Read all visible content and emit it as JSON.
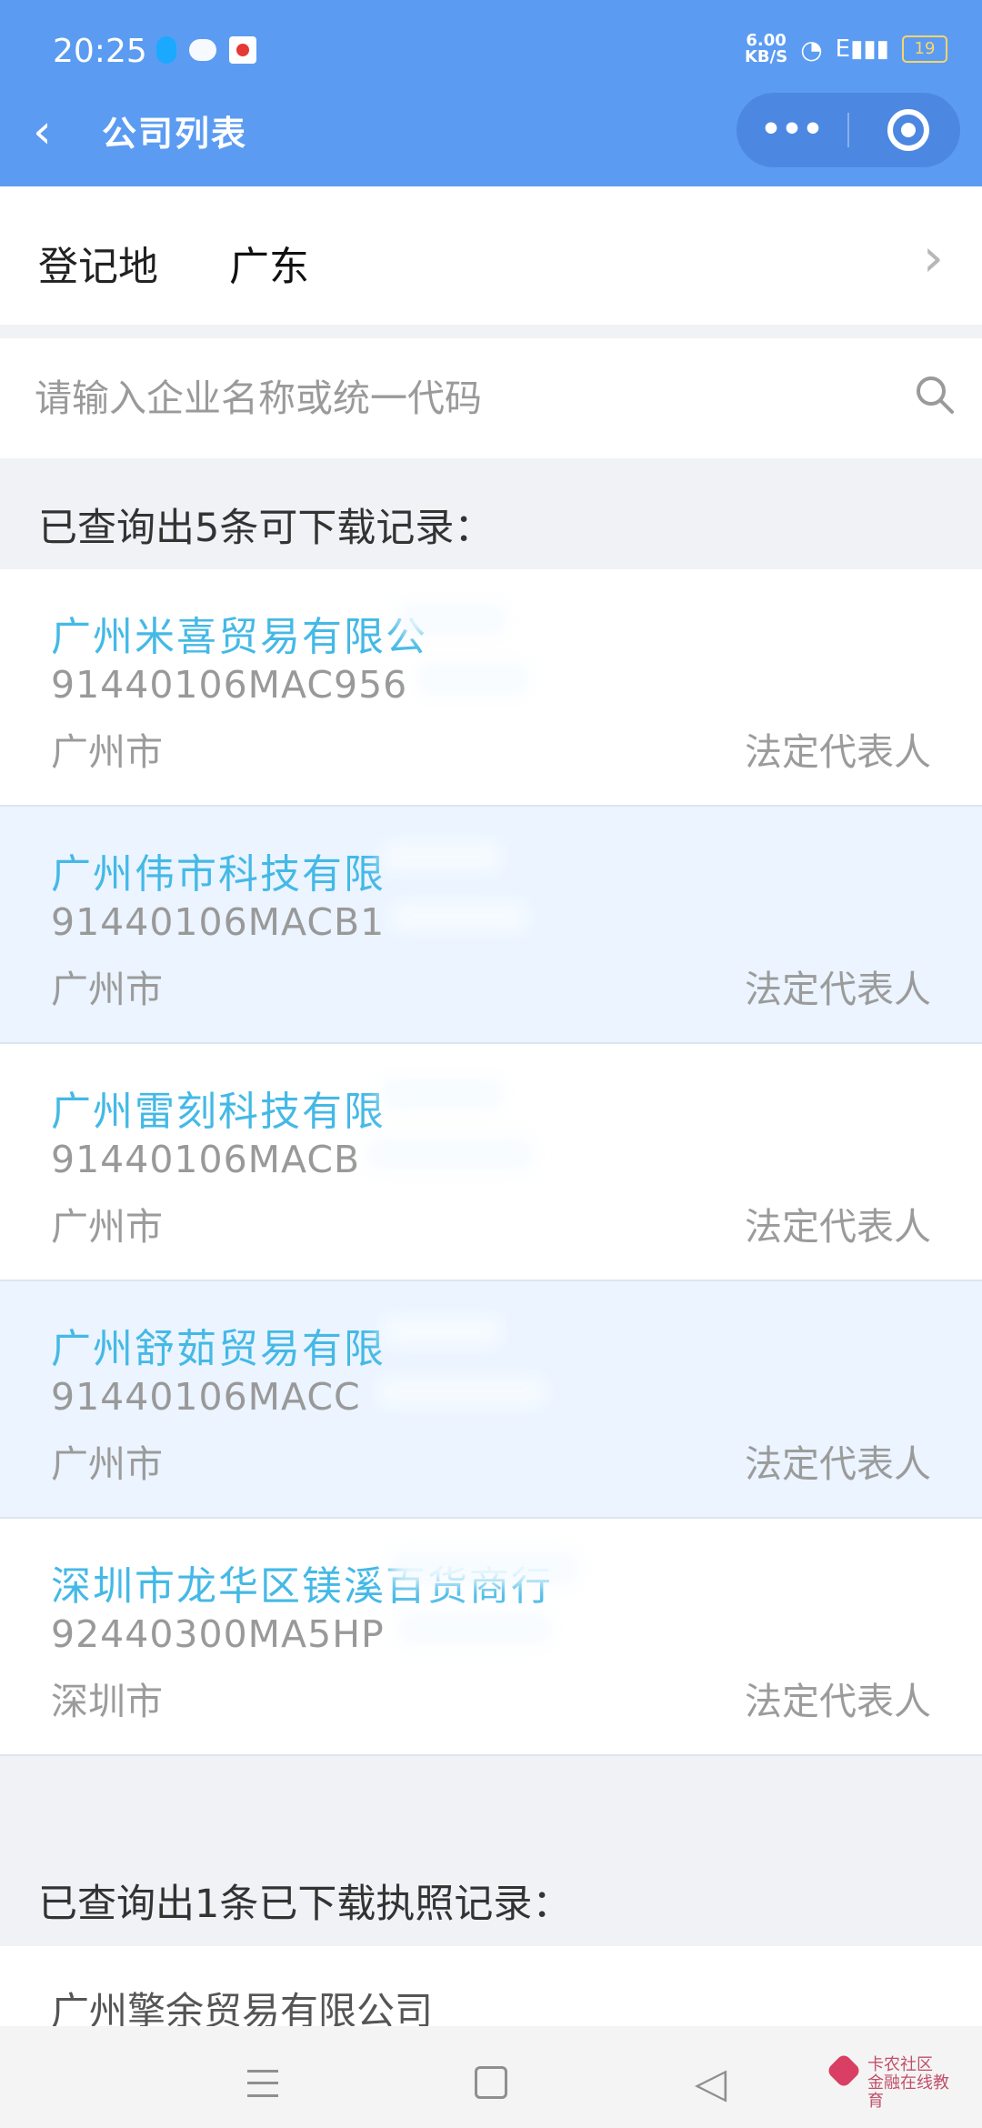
{
  "status_bar": {
    "time": "20:25",
    "speed_value": "6.00",
    "speed_unit": "KB/S",
    "network_label": "E",
    "battery": "19"
  },
  "header": {
    "back_icon": "back-icon",
    "title": "公司列表",
    "more_label": "•••",
    "close_icon": "target-icon",
    "colors": {
      "brand": "#5b9cf2",
      "capsule": "#4c88e2"
    }
  },
  "region": {
    "label": "登记地",
    "value": "广东",
    "arrow": "›"
  },
  "search": {
    "placeholder": "请输入企业名称或统一代码",
    "value": ""
  },
  "results": {
    "heading": "已查询出5条可下载记录：",
    "items": [
      {
        "name": "广州米喜贸易有限公",
        "code": "91440106MAC956",
        "city": "广州市",
        "rep": "法定代表人"
      },
      {
        "name": "广州伟市科技有限",
        "code": "91440106MACB1",
        "city": "广州市",
        "rep": "法定代表人"
      },
      {
        "name": "广州雷刻科技有限",
        "code": "91440106MACB",
        "city": "广州市",
        "rep": "法定代表人"
      },
      {
        "name": "广州舒茹贸易有限",
        "code": "91440106MACC",
        "city": "广州市",
        "rep": "法定代表人"
      },
      {
        "name": "深圳市龙华区镁溪百货商行",
        "code": "92440300MA5HP",
        "city": "深圳市",
        "rep": "法定代表人"
      }
    ]
  },
  "downloaded": {
    "heading": "已查询出1条已下载执照记录：",
    "items": [
      {
        "name": "广州擎余贸易有限公司"
      }
    ]
  },
  "watermark": {
    "title": "卡农社区",
    "subtitle": "金融在线教育"
  }
}
